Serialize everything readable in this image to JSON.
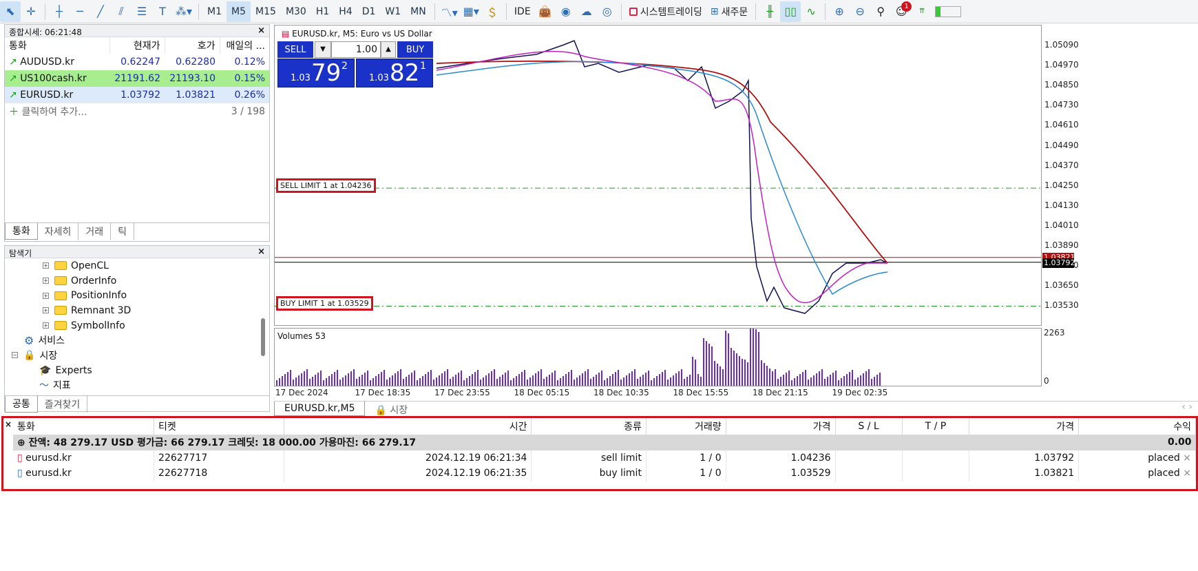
{
  "toolbar": {
    "timeframes": [
      "M1",
      "M5",
      "M15",
      "M30",
      "H1",
      "H4",
      "D1",
      "W1",
      "MN"
    ],
    "active_timeframe": "M5",
    "ide": "IDE",
    "algo_trading": "시스템트레이딩",
    "new_order": "새주문",
    "notification_count": "1"
  },
  "market_watch": {
    "title": "종합시세: 06:21:48",
    "columns": [
      "통화",
      "현재가",
      "호가",
      "매일의 ..."
    ],
    "rows": [
      {
        "symbol": "AUDUSD.kr",
        "bid": "0.62247",
        "ask": "0.62280",
        "change": "0.12%"
      },
      {
        "symbol": "US100cash.kr",
        "bid": "21191.62",
        "ask": "21193.10",
        "change": "0.15%"
      },
      {
        "symbol": "EURUSD.kr",
        "bid": "1.03792",
        "ask": "1.03821",
        "change": "0.26%"
      }
    ],
    "add_label": "클릭하여 추가...",
    "count": "3 / 198",
    "tabs": [
      "통화",
      "자세히",
      "거래",
      "틱"
    ]
  },
  "navigator": {
    "title": "탐색기",
    "items": [
      "OpenCL",
      "OrderInfo",
      "PositionInfo",
      "Remnant 3D",
      "SymbolInfo",
      "서비스",
      "시장",
      "Experts",
      "지표"
    ],
    "tabs": [
      "공통",
      "즐겨찾기"
    ]
  },
  "chart": {
    "title": "EURUSD.kr, M5:  Euro vs US Dollar",
    "sell_label": "SELL",
    "buy_label": "BUY",
    "volume": "1.00",
    "sell_price": {
      "small": "1.03",
      "big": "79",
      "sup": "2"
    },
    "buy_price": {
      "small": "1.03",
      "big": "82",
      "sup": "1"
    },
    "sell_limit_label": "SELL LIMIT 1 at 1.04236",
    "buy_limit_label": "BUY LIMIT 1 at 1.03529",
    "y_ticks": [
      "1.05090",
      "1.04970",
      "1.04850",
      "1.04730",
      "1.04610",
      "1.04490",
      "1.04370",
      "1.04250",
      "1.04130",
      "1.04010",
      "1.03890",
      "1.03770",
      "1.03650",
      "1.03530"
    ],
    "ask_marker": "1.03821",
    "bid_marker": "1.03792",
    "volume_label": "Volumes 53",
    "vol_max": "2263",
    "vol_min": "0",
    "x_ticks": [
      "17 Dec 2024",
      "17 Dec 18:35",
      "17 Dec 23:55",
      "18 Dec 05:15",
      "18 Dec 10:35",
      "18 Dec 15:55",
      "18 Dec 21:15",
      "19 Dec 02:35"
    ],
    "tabs": [
      "EURUSD.kr,M5",
      "시장"
    ]
  },
  "colors": {
    "sell_limit": "#1a9a1a",
    "red_ma": "#b01010",
    "magenta_ma": "#c020c0",
    "blue_ma": "#2a8ad0",
    "price": "#101050",
    "highlight": "#d0141e",
    "volume": "#6a2ad0"
  },
  "terminal": {
    "columns": [
      "통화",
      "티켓",
      "시간",
      "종류",
      "거래량",
      "가격",
      "S / L",
      "T / P",
      "가격",
      "수익"
    ],
    "summary": "잔액: 48 279.17 USD  평가금: 66 279.17  크레딧: 18 000.00  가용마진: 66 279.17",
    "summary_profit": "0.00",
    "rows": [
      {
        "symbol": "eurusd.kr",
        "ticket": "22627717",
        "time": "2024.12.19 06:21:34",
        "type": "sell limit",
        "volume": "1 / 0",
        "price": "1.04236",
        "sl": "",
        "tp": "",
        "cur": "1.03792",
        "profit": "placed"
      },
      {
        "symbol": "eurusd.kr",
        "ticket": "22627718",
        "time": "2024.12.19 06:21:35",
        "type": "buy limit",
        "volume": "1 / 0",
        "price": "1.03529",
        "sl": "",
        "tp": "",
        "cur": "1.03821",
        "profit": "placed"
      }
    ]
  }
}
